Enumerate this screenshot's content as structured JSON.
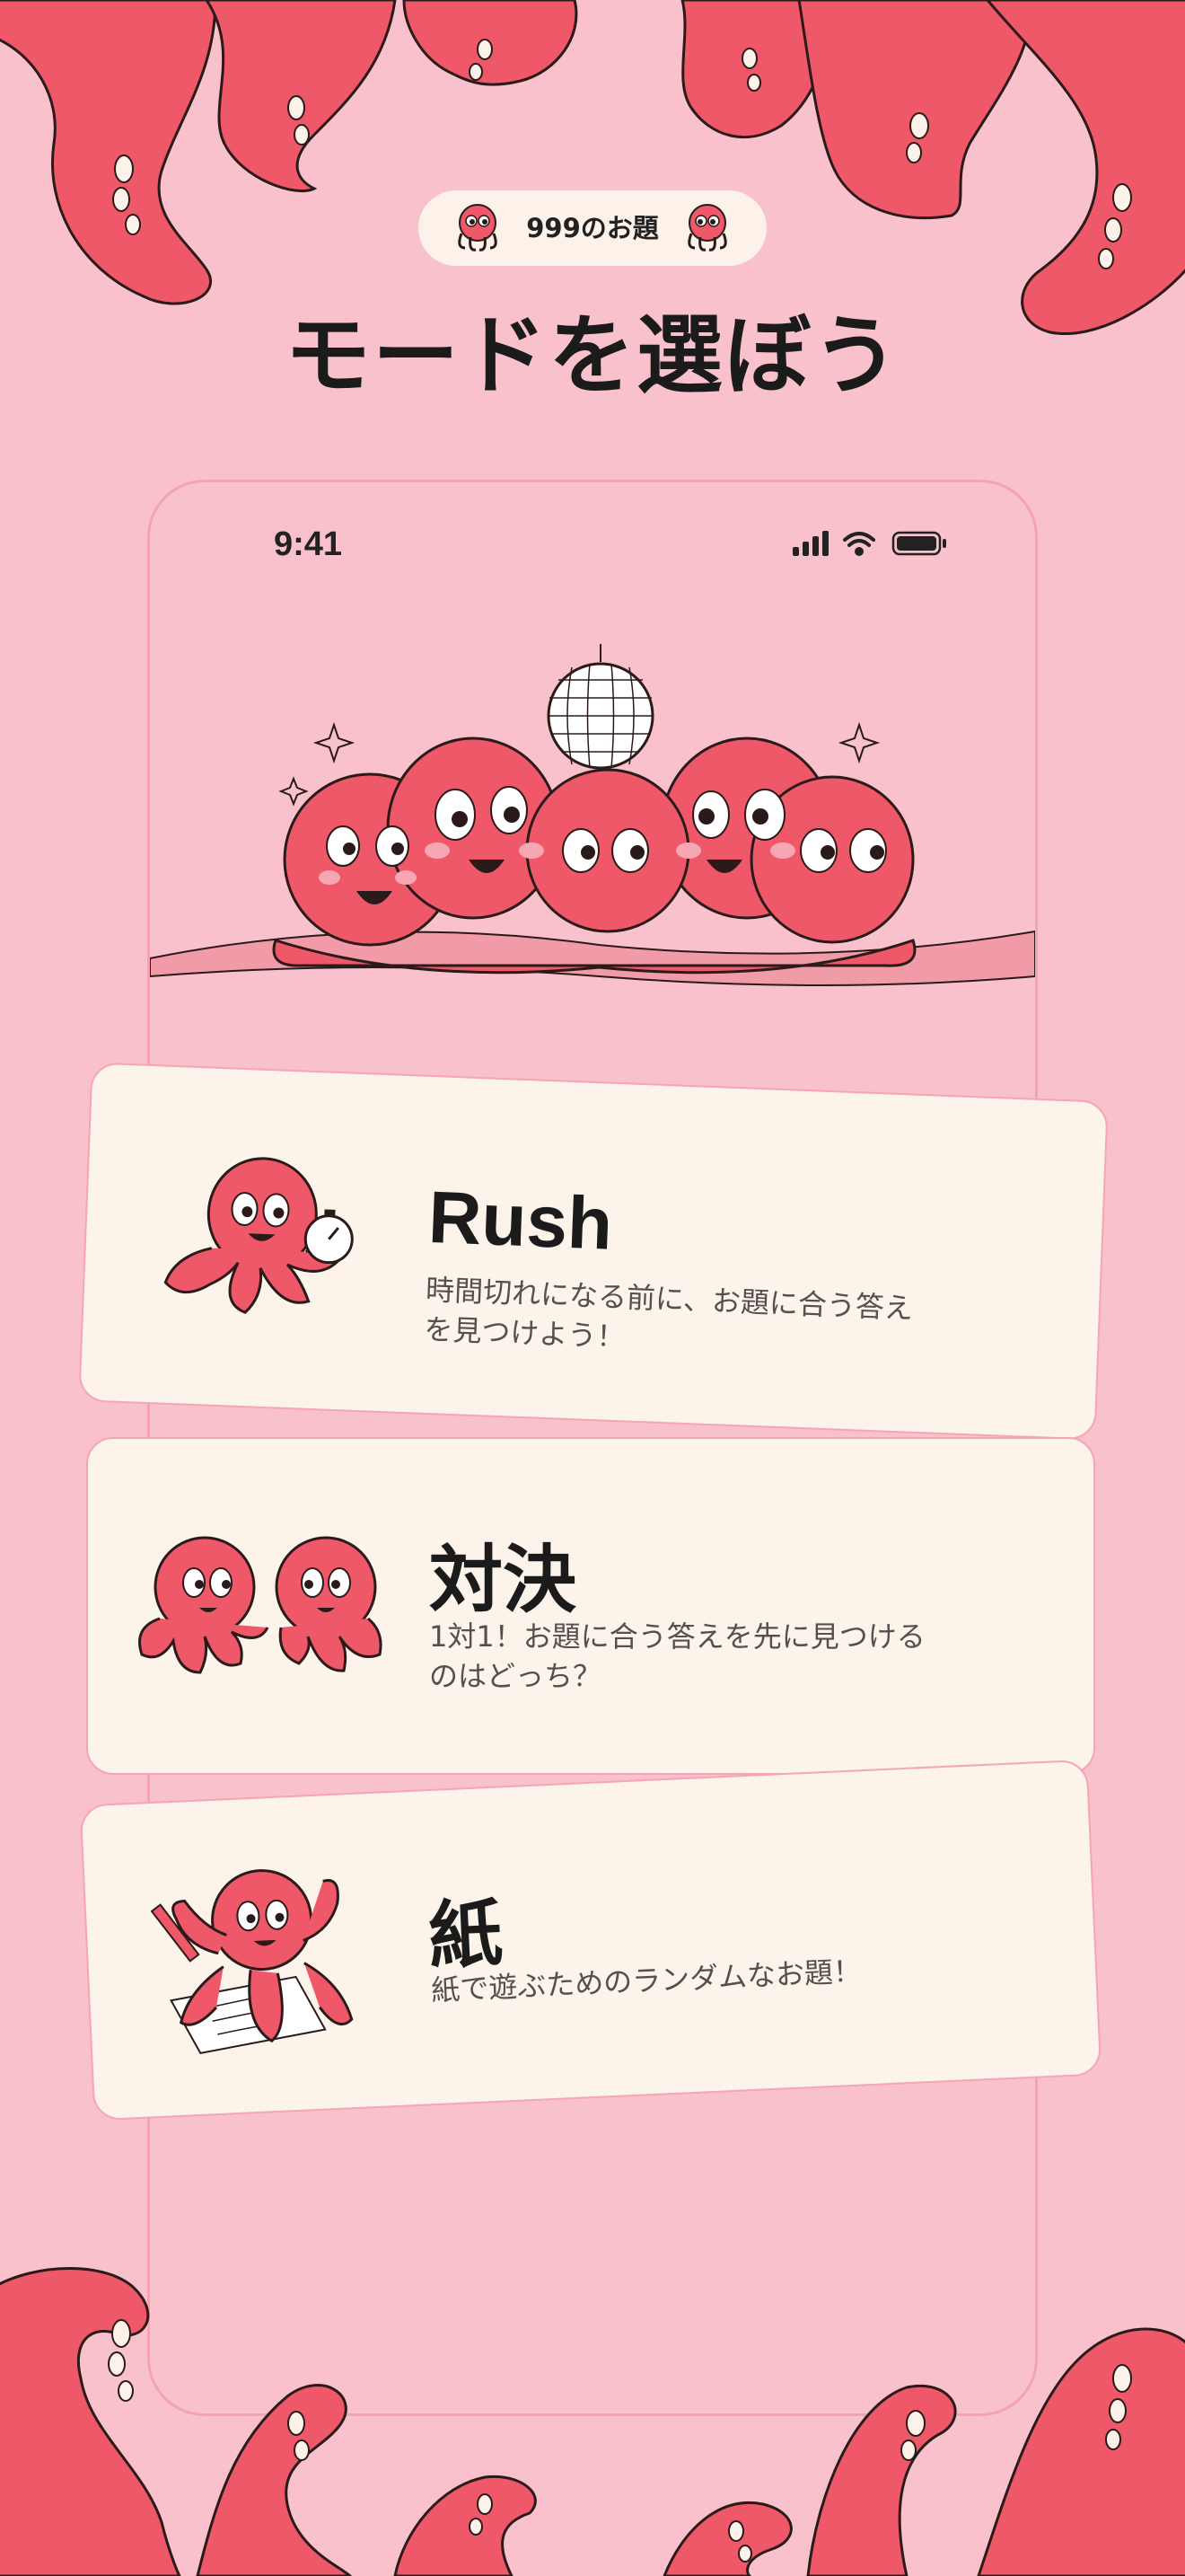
{
  "badge": {
    "label": "999のお題"
  },
  "heading": {
    "title": "モードを選ぼう"
  },
  "status_bar": {
    "time": "9:41"
  },
  "modes": [
    {
      "title": "Rush",
      "description": "時間切れになる前に、お題に合う答えを見つけよう！"
    },
    {
      "title": "対決",
      "description": "1対1！お題に合う答えを先に見つけるのはどっち？"
    },
    {
      "title": "紙",
      "description": "紙で遊ぶためのランダムなお題！"
    }
  ],
  "colors": {
    "background": "#f8c1cb",
    "octopus": "#ee5868",
    "card": "#fcf3ea",
    "text": "#1c1b1b",
    "accent_border": "#f4a6b5"
  },
  "icons": [
    "octopus-icon",
    "signal-icon",
    "wifi-icon",
    "battery-icon",
    "disco-ball-icon",
    "stopwatch-icon",
    "pencil-icon",
    "paper-icon"
  ]
}
